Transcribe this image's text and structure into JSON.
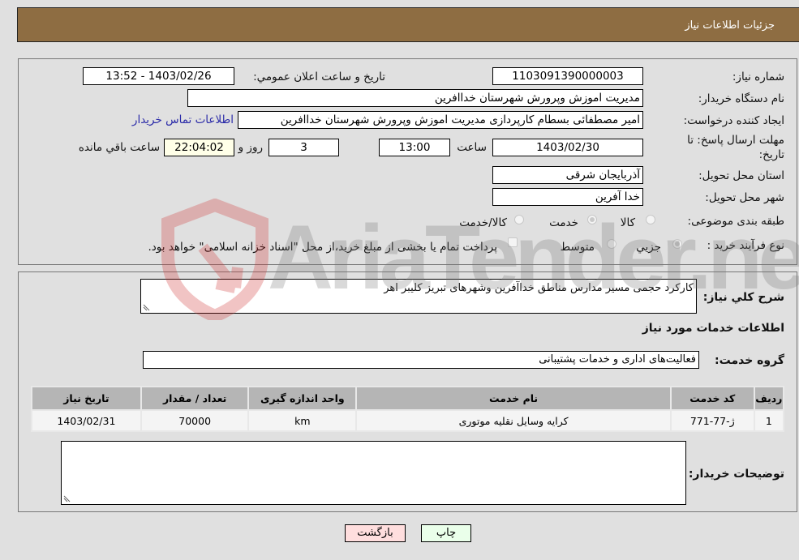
{
  "header": {
    "title": "جزئیات اطلاعات نیاز"
  },
  "details": {
    "need_number": {
      "label": "شماره نیاز:",
      "value": "1103091390000003"
    },
    "announce_datetime": {
      "label": "تاریخ و ساعت اعلان عمومي:",
      "value": "1403/02/26 - 13:52"
    },
    "buyer_org": {
      "label": "نام دستگاه خریدار:",
      "value": "مدیریت اموزش وپرورش شهرستان خداافرین"
    },
    "requester": {
      "label": "ایجاد کننده درخواست:",
      "value": "امیر مصطفائی بسطام کارپردازی مدیریت اموزش وپرورش شهرستان خداافرین"
    },
    "contact_link": "اطلاعات تماس خریدار",
    "deadline": {
      "label": "مهلت ارسال پاسخ: تا تاریخ:",
      "date": "1403/02/30",
      "time_label": "ساعت",
      "time": "13:00",
      "days": "3",
      "days_label": "روز و",
      "remaining": "22:04:02",
      "remaining_label": "ساعت باقي مانده"
    },
    "province": {
      "label": "استان محل تحویل:",
      "value": "آذربایجان شرقی"
    },
    "city": {
      "label": "شهر محل تحویل:",
      "value": "خدا آفرین"
    },
    "category": {
      "label": "طبقه بندی موضوعی:",
      "options": [
        "کالا",
        "خدمت",
        "کالا/خدمت"
      ],
      "selected": "خدمت"
    },
    "purchase_type": {
      "label": "نوع فرآیند خرید :",
      "options": [
        "جزيي",
        "متوسط"
      ],
      "selected": "جزيي",
      "treasury_note": "پرداخت تمام یا بخشی از مبلغ خرید،از محل \"اسناد خزانه اسلامی\" خواهد بود."
    }
  },
  "summary": {
    "label": "شرح کلي نياز:",
    "value": "کارکرد حجمی مسیر مدارس مناطق خداآفرین وشهرهای تبریز کلیبر اهر"
  },
  "services": {
    "title": "اطلاعات خدمات مورد نياز",
    "group_label": "گروه خدمت:",
    "group_value": "فعالیت‌های اداری و خدمات پشتیبانی",
    "columns": [
      "رديف",
      "کد خدمت",
      "نام خدمت",
      "واحد اندازه گيری",
      "تعداد / مقدار",
      "تاريخ نياز"
    ],
    "rows": [
      [
        "1",
        "ژ-77-771",
        "کرایه وسایل نقلیه موتوری",
        "km",
        "70000",
        "1403/02/31"
      ]
    ]
  },
  "buyer_notes": {
    "label": "توضيحات خريدار:",
    "value": ""
  },
  "buttons": {
    "print": "چاپ",
    "back": "بازگشت"
  },
  "watermark": {
    "text": "AriaTender.neT"
  },
  "colors": {
    "header_bg": "#8e6d42",
    "link": "#2a2aa8",
    "back_btn": "#ffdede",
    "print_btn": "#eaffea"
  }
}
